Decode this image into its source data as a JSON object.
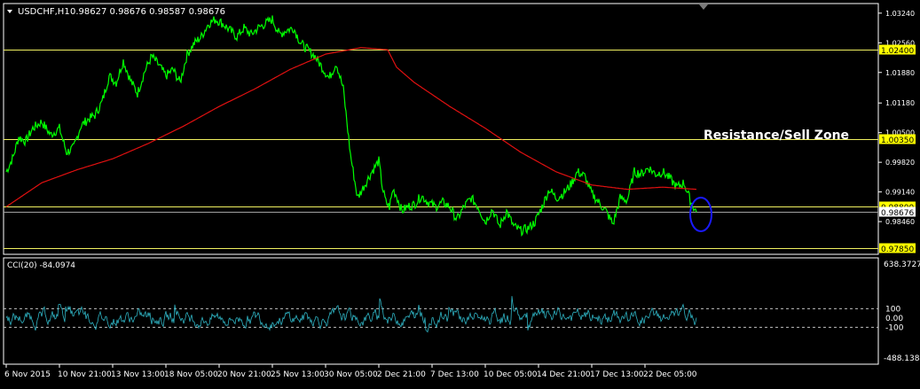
{
  "header": {
    "symbol_label": "USDCHF,H1",
    "ohlc": "0.98627 0.98676 0.98587 0.98676",
    "menu_icon": "triangle-down-icon"
  },
  "annotation_text": "Resistance/Sell Zone",
  "indicator": {
    "label": "CCI(20) -84.0974",
    "axis_top": "638.3727",
    "axis_bottom": "-488.1384",
    "level_labels": [
      "100",
      "0.00",
      "-100"
    ],
    "cci_color": "#2fb4c4"
  },
  "colors": {
    "background": "#000000",
    "frame": "#ffffff",
    "price": "#00ff00",
    "moving_average": "#e01010",
    "levels": "#f0f060",
    "level_tag_bg": "#ffff00",
    "gray_line": "#a0a0a0",
    "highlight_circle": "#1a1aff",
    "annotation": "#ffffff"
  },
  "chart_data": {
    "type": "line",
    "symbol": "USDCHF",
    "timeframe": "H1",
    "y_tick_labels": [
      "1.03240",
      "1.02560",
      "1.01880",
      "1.01180",
      "1.00500",
      "0.99820",
      "0.99140",
      "0.98460"
    ],
    "y_ticks": [
      1.0324,
      1.0256,
      1.0188,
      1.0118,
      1.005,
      0.9982,
      0.9914,
      0.9846
    ],
    "ylim": [
      0.9773,
      1.0344
    ],
    "x_labels": [
      "6 Nov 2015",
      "10 Nov 21:00",
      "13 Nov 13:00",
      "18 Nov 05:00",
      "20 Nov 21:00",
      "25 Nov 13:00",
      "30 Nov 05:00",
      "2 Dec 21:00",
      "7 Dec 13:00",
      "10 Dec 05:00",
      "14 Dec 21:00",
      "17 Dec 13:00",
      "22 Dec 05:00"
    ],
    "x_label_index": [
      0,
      60,
      120,
      180,
      240,
      300,
      360,
      420,
      480,
      540,
      600,
      660,
      720
    ],
    "grid": false,
    "horizontal_levels": [
      {
        "value": 1.024,
        "label": "1.02400"
      },
      {
        "value": 1.0035,
        "label": "1.00350"
      },
      {
        "value": 0.988,
        "label": "0.98800"
      },
      {
        "value": 0.9785,
        "label": "0.97850"
      }
    ],
    "current_price_label": "0.98676",
    "current_price": 0.98676,
    "series": [
      {
        "role": "price",
        "index": [
          0,
          8,
          14,
          22,
          30,
          40,
          50,
          60,
          68,
          76,
          84,
          92,
          100,
          108,
          116,
          124,
          132,
          140,
          148,
          156,
          164,
          172,
          180,
          188,
          196,
          204,
          212,
          220,
          228,
          236,
          244,
          252,
          260,
          268,
          276,
          284,
          292,
          300,
          308,
          316,
          324,
          332,
          340,
          348,
          356,
          364,
          372,
          380,
          388,
          396,
          404,
          412,
          420,
          424,
          428,
          432,
          436,
          440,
          446,
          452,
          460,
          468,
          476,
          484,
          492,
          500,
          508,
          516,
          524,
          532,
          540,
          548,
          556,
          564,
          572,
          580,
          588,
          596,
          604,
          612,
          620,
          628,
          636,
          644,
          652,
          660,
          668,
          676,
          684,
          692,
          700,
          708,
          716,
          724,
          732,
          740,
          748,
          756,
          764,
          772,
          778
        ],
        "values": [
          0.996,
          0.9995,
          1.004,
          1.003,
          1.006,
          1.0075,
          1.0045,
          1.006,
          1.0005,
          1.0015,
          1.0065,
          1.008,
          1.009,
          1.012,
          1.018,
          1.0165,
          1.0215,
          1.017,
          1.014,
          1.019,
          1.0225,
          1.0205,
          1.018,
          1.0195,
          1.0165,
          1.023,
          1.0255,
          1.027,
          1.03,
          1.031,
          1.03,
          1.0285,
          1.027,
          1.029,
          1.0275,
          1.029,
          1.03,
          1.031,
          1.0275,
          1.0285,
          1.029,
          1.0255,
          1.024,
          1.0225,
          1.02,
          1.0175,
          1.021,
          1.015,
          1.0,
          0.99,
          0.993,
          0.996,
          0.9985,
          0.9925,
          0.989,
          0.988,
          0.992,
          0.9905,
          0.987,
          0.988,
          0.9885,
          0.9905,
          0.989,
          0.988,
          0.989,
          0.988,
          0.985,
          0.988,
          0.99,
          0.988,
          0.9845,
          0.9875,
          0.9835,
          0.987,
          0.9835,
          0.9825,
          0.983,
          0.9845,
          0.988,
          0.992,
          0.99,
          0.991,
          0.993,
          0.996,
          0.995,
          0.991,
          0.989,
          0.987,
          0.984,
          0.99,
          0.9895,
          0.996,
          0.9955,
          0.997,
          0.9955,
          0.996,
          0.9945,
          0.9925,
          0.9935,
          0.989,
          0.98676
        ]
      },
      {
        "role": "moving average",
        "index": [
          0,
          40,
          80,
          120,
          160,
          200,
          240,
          280,
          320,
          360,
          400,
          430,
          440,
          460,
          500,
          540,
          580,
          620,
          660,
          700,
          740,
          778
        ],
        "values": [
          0.988,
          0.9935,
          0.9965,
          0.999,
          1.0025,
          1.0065,
          1.011,
          1.015,
          1.0195,
          1.023,
          1.0245,
          1.024,
          1.02,
          1.0165,
          1.011,
          1.006,
          1.0005,
          0.996,
          0.993,
          0.992,
          0.9925,
          0.992
        ]
      }
    ],
    "indicator_levels": [
      100,
      0,
      -100
    ],
    "indicator_ylim": [
      -488.1384,
      638.3727
    ]
  }
}
